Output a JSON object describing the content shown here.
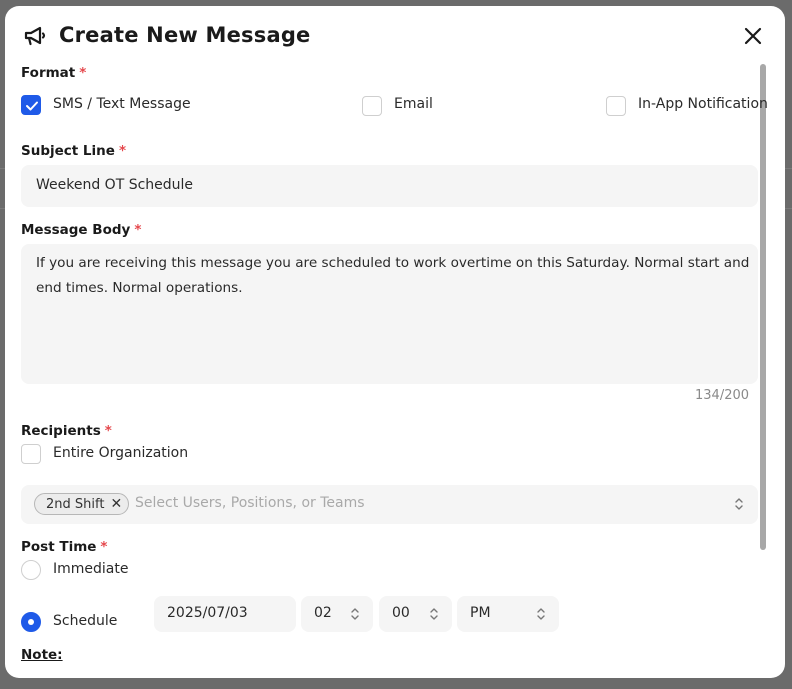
{
  "modal": {
    "title": "Create New Message",
    "format": {
      "label": "Format",
      "options": [
        {
          "label": "SMS / Text Message",
          "checked": true
        },
        {
          "label": "Email",
          "checked": false
        },
        {
          "label": "In-App Notification",
          "checked": false
        }
      ]
    },
    "subject": {
      "label": "Subject Line",
      "value": "Weekend OT Schedule"
    },
    "body": {
      "label": "Message Body",
      "line1": "If you are receiving this message you are scheduled to work overtime on this Saturday.  Normal start and",
      "line2": "end times. Normal operations.",
      "counter": "134/200"
    },
    "recipients": {
      "label": "Recipients",
      "entire_org": "Entire Organization",
      "chip": "2nd Shift",
      "chip_remove": "✕",
      "placeholder": "Select Users, Positions, or Teams"
    },
    "post_time": {
      "label": "Post Time",
      "immediate": "Immediate",
      "schedule": "Schedule",
      "date": "2025/07/03",
      "hour": "02",
      "minute": "00",
      "ampm": "PM",
      "selected": "Schedule"
    },
    "note_label": "Note:",
    "required_mark": "*"
  },
  "colors": {
    "accent": "#1f5ae8",
    "required": "#e5484d",
    "field_bg": "#f5f5f5"
  }
}
